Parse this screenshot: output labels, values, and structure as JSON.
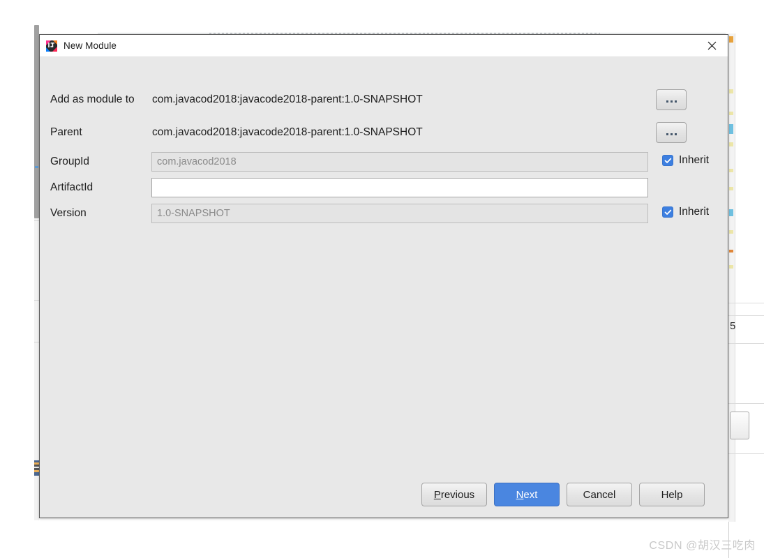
{
  "window": {
    "title": "New Module",
    "icon": "intellij-idea-icon",
    "close_icon": "close-icon"
  },
  "form": {
    "add_as_module_to": {
      "label": "Add as module to",
      "value": "com.javacod2018:javacode2018-parent:1.0-SNAPSHOT",
      "browse_label": "...",
      "browse_icon": "ellipsis-icon"
    },
    "parent": {
      "label": "Parent",
      "value": "com.javacod2018:javacode2018-parent:1.0-SNAPSHOT",
      "browse_label": "...",
      "browse_icon": "ellipsis-icon"
    },
    "group_id": {
      "label": "GroupId",
      "value": "com.javacod2018",
      "placeholder": "com.javacod2018",
      "enabled": false,
      "inherit_label": "Inherit",
      "inherit_checked": true
    },
    "artifact_id": {
      "label": "ArtifactId",
      "value": "",
      "placeholder": "",
      "enabled": true
    },
    "version": {
      "label": "Version",
      "value": "1.0-SNAPSHOT",
      "placeholder": "1.0-SNAPSHOT",
      "enabled": false,
      "inherit_label": "Inherit",
      "inherit_checked": true
    }
  },
  "footer": {
    "previous": {
      "mnemonic": "P",
      "rest": "revious"
    },
    "next": {
      "mnemonic": "N",
      "rest": "ext"
    },
    "cancel": "Cancel",
    "help": "Help"
  },
  "watermark": "CSDN @胡汉三吃肉",
  "colors": {
    "dialog_background": "#e8e8e8",
    "titlebar_background": "#ffffff",
    "primary_button": "#4a86e0",
    "checkbox_checked": "#3d7fe0",
    "disabled_field": "#e4e4e4",
    "disabled_text": "#8a8a8a",
    "text": "#1d1d1d",
    "watermark": "#c9c9c9"
  }
}
